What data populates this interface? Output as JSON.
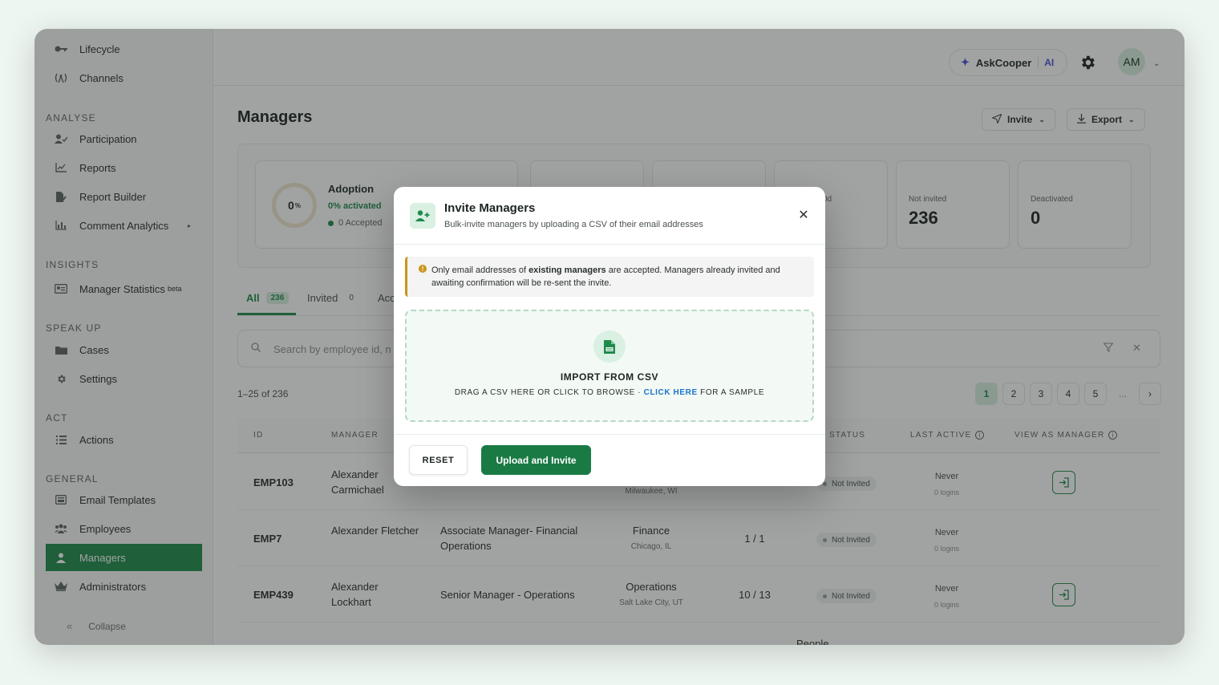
{
  "sidebar": {
    "items_top": [
      {
        "label": "Lifecycle",
        "icon": "key-icon"
      },
      {
        "label": "Channels",
        "icon": "broadcast-icon"
      }
    ],
    "sections": {
      "analyse": "ANALYSE",
      "insights": "INSIGHTS",
      "speak_up": "SPEAK UP",
      "act": "ACT",
      "general": "GENERAL"
    },
    "analyse_items": [
      {
        "label": "Participation"
      },
      {
        "label": "Reports"
      },
      {
        "label": "Report Builder"
      },
      {
        "label": "Comment Analytics"
      }
    ],
    "insights_item": {
      "label": "Manager Statistics",
      "tag": "beta"
    },
    "speak_up_items": [
      {
        "label": "Cases"
      },
      {
        "label": "Settings"
      }
    ],
    "act_items": [
      {
        "label": "Actions"
      }
    ],
    "general_items": [
      {
        "label": "Email Templates"
      },
      {
        "label": "Employees"
      },
      {
        "label": "Managers"
      },
      {
        "label": "Administrators"
      }
    ],
    "collapse_label": "Collapse"
  },
  "topbar": {
    "ask_label": "AskCooper",
    "ask_ai": "AI",
    "avatar_initials": "AM"
  },
  "page": {
    "title": "Managers",
    "invite_label": "Invite",
    "export_label": "Export"
  },
  "stats": {
    "adoption_title": "Adoption",
    "adoption_percent": "0",
    "adoption_percent_unit": "%",
    "adoption_activated": "0% activated",
    "adoption_accepted": "0 Accepted",
    "partial_label": "0d",
    "not_invited_label": "Not invited",
    "not_invited_value": "236",
    "deactivated_label": "Deactivated",
    "deactivated_value": "0"
  },
  "tabs": [
    {
      "label": "All",
      "count": "236"
    },
    {
      "label": "Invited",
      "count": "0"
    },
    {
      "label": "Acc",
      "count": ""
    }
  ],
  "search": {
    "placeholder": "Search by employee id, n"
  },
  "pagination": {
    "range": "1–25 of 236",
    "pages": [
      "1",
      "2",
      "3",
      "4",
      "5",
      "...",
      "›"
    ]
  },
  "table": {
    "headers": {
      "id": "ID",
      "manager": "MANAGER",
      "status": "STATUS",
      "last_active": "LAST ACTIVE",
      "view_as_manager": "VIEW AS MANAGER"
    },
    "rows": [
      {
        "id": "EMP103",
        "manager": "Alexander Carmichael",
        "title": "",
        "dept": "",
        "location": "Milwaukee, WI",
        "ratio": "",
        "status": "Not Invited",
        "last_active": "Never",
        "logins": "0 logins",
        "view": true
      },
      {
        "id": "EMP7",
        "manager": "Alexander Fletcher",
        "title": "Associate Manager- Financial Operations",
        "dept": "Finance",
        "location": "Chicago, IL",
        "ratio": "1 / 1",
        "status": "Not Invited",
        "last_active": "Never",
        "logins": "0 logins",
        "view": false
      },
      {
        "id": "EMP439",
        "manager": "Alexander Lockhart",
        "title": "Senior Manager - Operations",
        "dept": "Operations",
        "location": "Salt Lake City, UT",
        "ratio": "10 / 13",
        "status": "Not Invited",
        "last_active": "Never",
        "logins": "0 logins",
        "view": true
      }
    ],
    "partial_row_dept": "People"
  },
  "modal": {
    "title": "Invite Managers",
    "subtitle": "Bulk-invite managers by uploading a CSV of their email addresses",
    "note_prefix": "Only email addresses of ",
    "note_bold": "existing managers",
    "note_suffix": " are accepted. Managers already invited and awaiting confirmation will be re-sent the invite.",
    "drop_heading": "IMPORT FROM CSV",
    "drop_text": "DRAG A CSV HERE OR CLICK TO BROWSE · ",
    "drop_link": "CLICK HERE",
    "drop_suffix": " FOR A SAMPLE",
    "reset_label": "RESET",
    "upload_label": "Upload and Invite"
  },
  "colors": {
    "accent": "#1f8a4c",
    "primary_button": "#1a7a44",
    "link": "#1a73c9",
    "warning": "#c9961a"
  }
}
